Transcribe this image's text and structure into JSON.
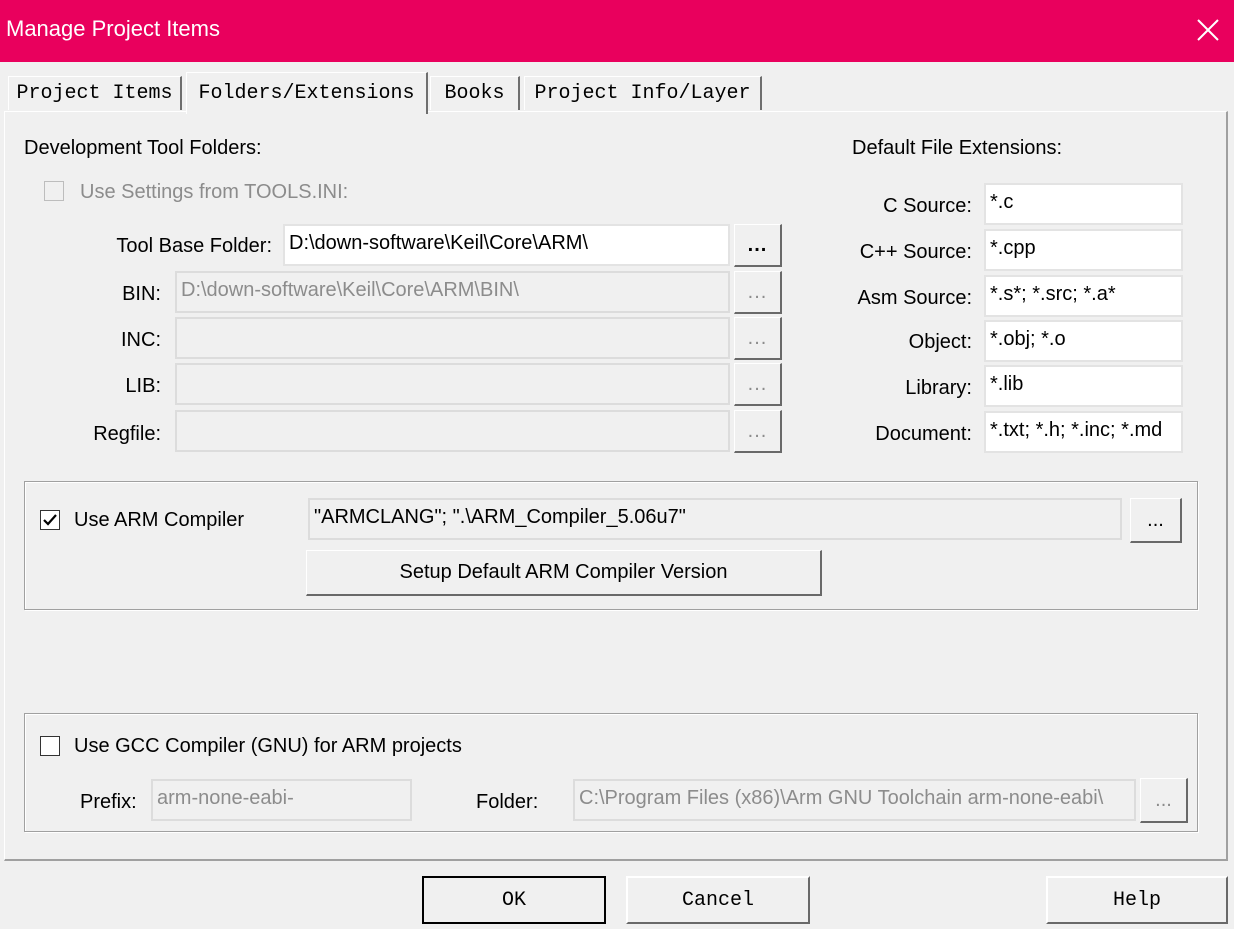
{
  "window": {
    "title": "Manage Project Items"
  },
  "tabs": [
    {
      "label": "Project Items"
    },
    {
      "label": "Folders/Extensions"
    },
    {
      "label": "Books"
    },
    {
      "label": "Project Info/Layer"
    }
  ],
  "dev_tools": {
    "heading": "Development Tool Folders:",
    "use_tools_ini": "Use Settings from TOOLS.INI:",
    "rows": [
      {
        "label": "Tool Base Folder:",
        "value": "D:\\down-software\\Keil\\Core\\ARM\\"
      },
      {
        "label": "BIN:",
        "value": "D:\\down-software\\Keil\\Core\\ARM\\BIN\\"
      },
      {
        "label": "INC:",
        "value": ""
      },
      {
        "label": "LIB:",
        "value": ""
      },
      {
        "label": "Regfile:",
        "value": ""
      }
    ],
    "browse_label": "..."
  },
  "extensions": {
    "heading": "Default File Extensions:",
    "rows": [
      {
        "label": "C Source:",
        "value": "*.c"
      },
      {
        "label": "C++ Source:",
        "value": "*.cpp"
      },
      {
        "label": "Asm Source:",
        "value": "*.s*; *.src; *.a*"
      },
      {
        "label": "Object:",
        "value": "*.obj; *.o"
      },
      {
        "label": "Library:",
        "value": "*.lib"
      },
      {
        "label": "Document:",
        "value": "*.txt; *.h; *.inc; *.md"
      }
    ]
  },
  "arm": {
    "checkbox_label": "Use ARM Compiler",
    "checked": true,
    "value": "\"ARMCLANG\"; \".\\ARM_Compiler_5.06u7\"",
    "setup_button": "Setup Default ARM Compiler Version"
  },
  "gcc": {
    "checkbox_label": "Use GCC Compiler (GNU) for ARM projects",
    "checked": false,
    "prefix_label": "Prefix:",
    "prefix_value": "arm-none-eabi-",
    "folder_label": "Folder:",
    "folder_value": "C:\\Program Files (x86)\\Arm GNU Toolchain arm-none-eabi\\"
  },
  "buttons": {
    "ok": "OK",
    "cancel": "Cancel",
    "help": "Help"
  },
  "colors": {
    "titlebar": "#e9005d",
    "face": "#f0f0f0"
  }
}
